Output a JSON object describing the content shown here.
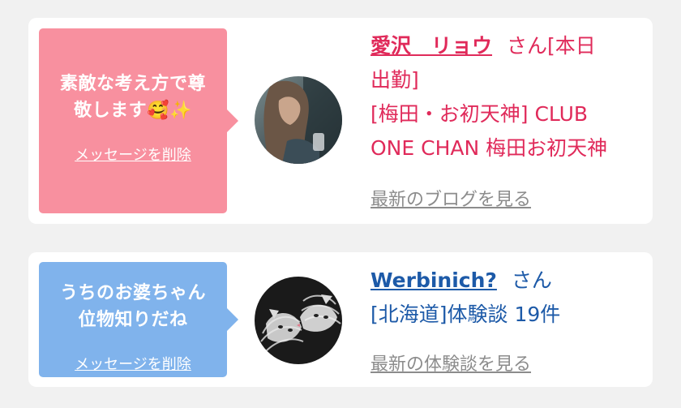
{
  "items": [
    {
      "message_line1": "素敵な考え方で尊",
      "message_line2": "敬します🥰✨",
      "delete_label": "メッセージを削除",
      "name": "愛沢　リョウ",
      "honorific": "さん[本日",
      "line2": "出勤]",
      "line3": "[梅田・お初天神] CLUB",
      "line4": "ONE CHAN 梅田お初天神",
      "more_label": "最新のブログを見る",
      "bubble_color": "#f8909f",
      "text_color": "#e02a5a"
    },
    {
      "message_line1": "うちのお婆ちゃん",
      "message_line2": "位物知りだね",
      "delete_label": "メッセージを削除",
      "name": "Werbinich?",
      "honorific": "さん",
      "line2": "[北海道]体験談 19件",
      "more_label": "最新の体験談を見る",
      "bubble_color": "#80b3ec",
      "text_color": "#1d5aa8"
    }
  ]
}
